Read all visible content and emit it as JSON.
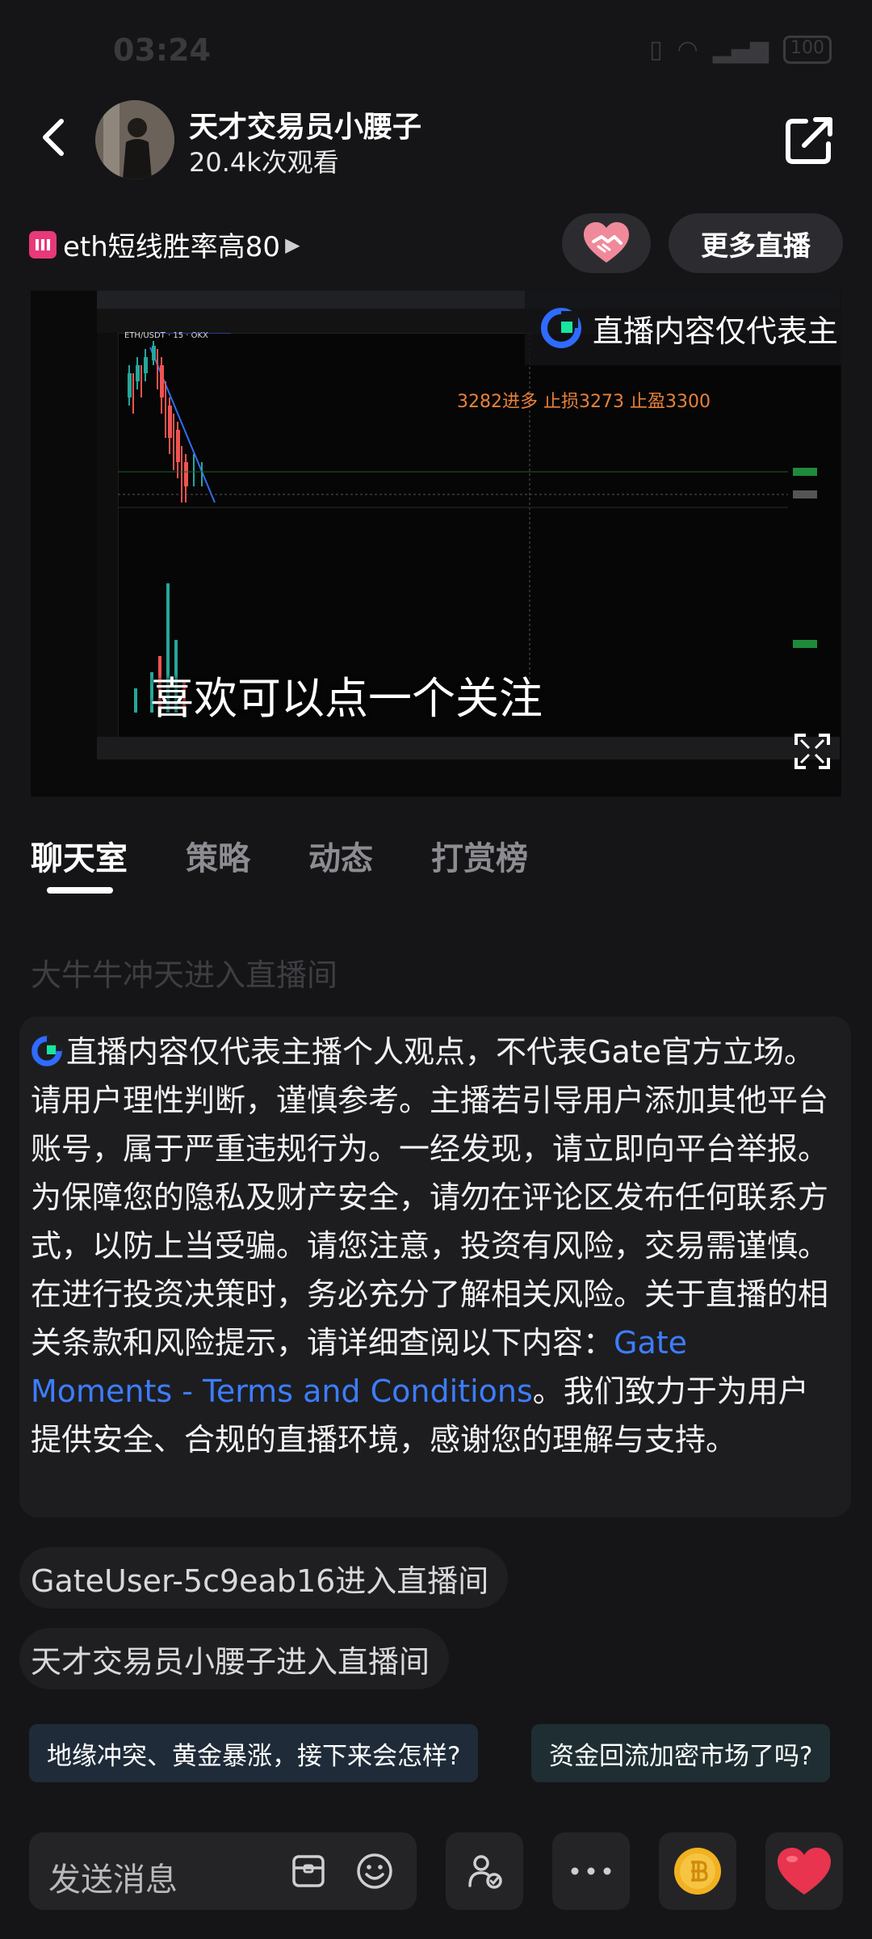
{
  "status_bar": {
    "time": "03:24",
    "battery": "100"
  },
  "header": {
    "host_name": "天才交易员小腰子",
    "views": "20.4k次观看"
  },
  "topic": {
    "title": "eth短线胜率高80",
    "more_live_label": "更多直播"
  },
  "video": {
    "banner_text": "直播内容仅代表主",
    "trade_note": "3282进多  止损3273  止盈3300",
    "subtitle": "喜欢可以点一个关注",
    "pair_label": "ETH/USDT · 15 · OKX"
  },
  "tabs": [
    "聊天室",
    "策略",
    "动态",
    "打赏榜"
  ],
  "chat": {
    "faded_message": "大牛牛冲天进入直播间",
    "notice": {
      "text": "直播内容仅代表主播个人观点，不代表Gate官方立场。请用户理性判断，谨慎参考。主播若引导用户添加其他平台账号，属于严重违规行为。一经发现，请立即向平台举报。为保障您的隐私及财产安全，请勿在评论区发布任何联系方式，以防上当受骗。请您注意，投资有风险，交易需谨慎。在进行投资决策时，务必充分了解相关风险。关于直播的相关条款和风险提示，请详细查阅以下内容：",
      "link_text": "Gate Moments - Terms and Conditions",
      "tail_text": "。我们致力于为用户提供安全、合规的直播环境，感谢您的理解与支持。"
    },
    "messages": [
      "GateUser-5c9eab16进入直播间",
      "天才交易员小腰子进入直播间"
    ]
  },
  "suggestions": [
    "地缘冲突、黄金暴涨，接下来会怎样?",
    "资金回流加密市场了吗?"
  ],
  "bottom_bar": {
    "input_placeholder": "发送消息"
  },
  "colors": {
    "accent_link": "#3d7dff",
    "like_red": "#e8344e",
    "coin_gold": "#f1b120",
    "note_orange": "#e8813a"
  }
}
